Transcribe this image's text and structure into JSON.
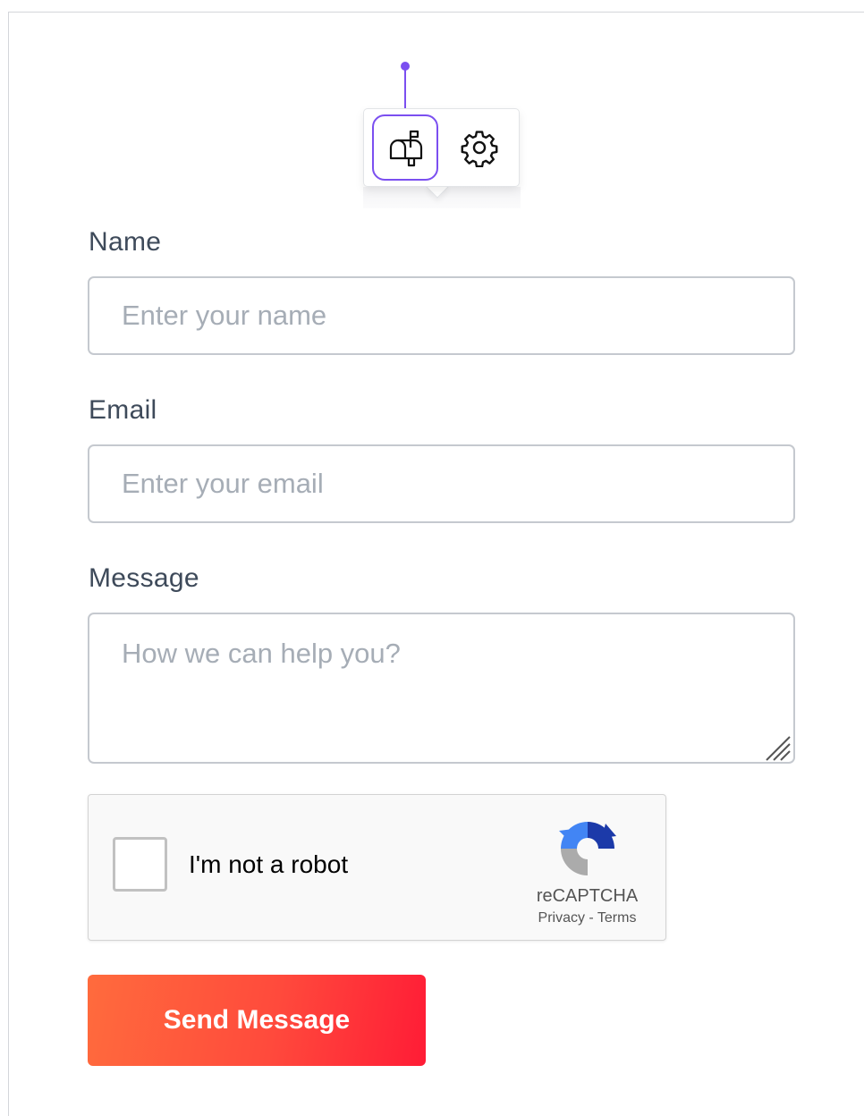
{
  "block_toolbar": {
    "buttons": [
      {
        "name": "mailbox",
        "icon": "mailbox-icon",
        "active": true
      },
      {
        "name": "settings",
        "icon": "gear-icon",
        "active": false
      }
    ],
    "accent_color": "#7b4ff0"
  },
  "form": {
    "name": {
      "label": "Name",
      "placeholder": "Enter your name"
    },
    "email": {
      "label": "Email",
      "placeholder": "Enter your email"
    },
    "message": {
      "label": "Message",
      "placeholder": "How we can help you?"
    },
    "captcha": {
      "checkbox_label": "I'm not a robot",
      "brand": "reCAPTCHA",
      "privacy": "Privacy",
      "separator": " - ",
      "terms": "Terms"
    },
    "submit_label": "Send Message",
    "submit_colors": [
      "#ff6b3d",
      "#ff1c36"
    ]
  }
}
